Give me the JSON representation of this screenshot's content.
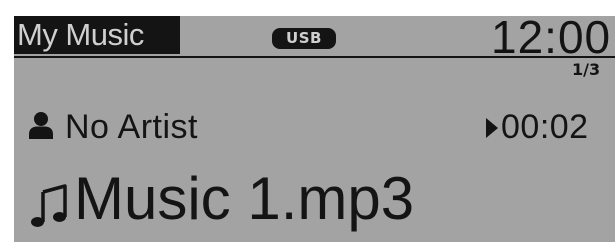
{
  "header": {
    "title": "My Music",
    "source_badge": "USB",
    "clock": "12:00"
  },
  "playback": {
    "track_count": "1/3",
    "artist": "No Artist",
    "elapsed": "00:02",
    "song": "Music 1.mp3"
  },
  "icons": {
    "artist": "person-icon",
    "state": "play-icon",
    "song": "music-note-icon"
  },
  "colors": {
    "screen_background": "#a3a3a3",
    "foreground": "#141414",
    "inverse_text": "#cfcfcf"
  }
}
